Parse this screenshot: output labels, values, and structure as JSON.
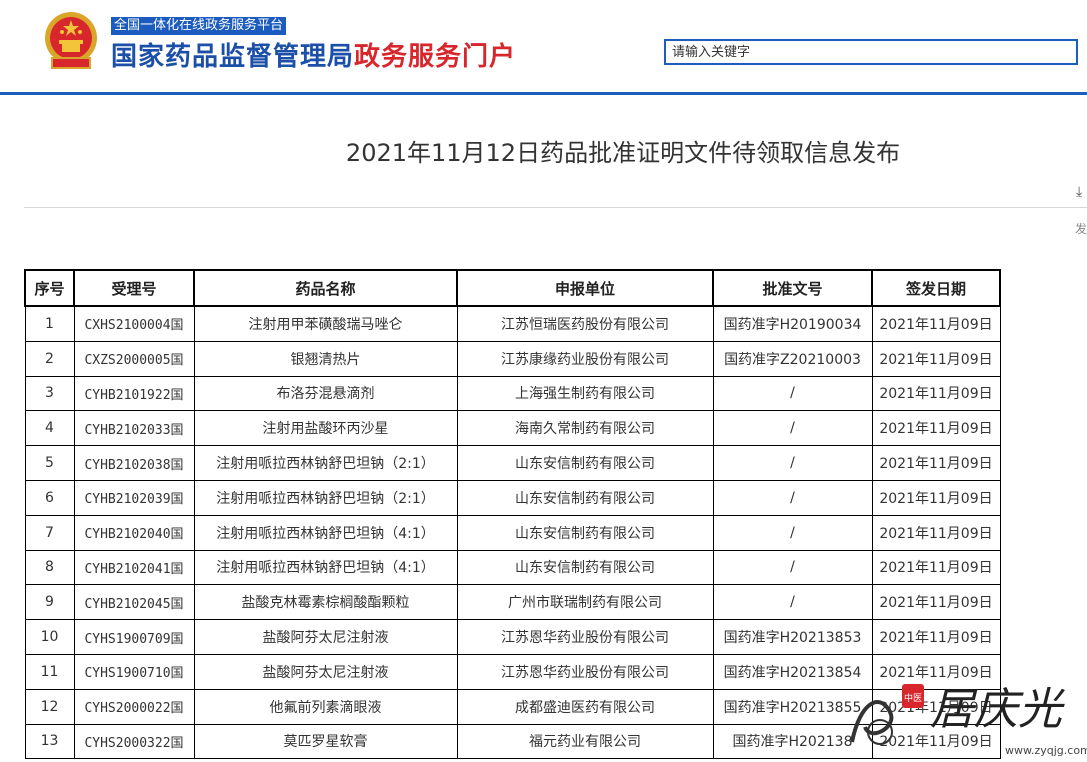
{
  "header": {
    "tagline": "全国一体化在线政务服务平台",
    "site_name_main": "国家药品监督管理局",
    "site_name_accent": "政务服务门户",
    "search_placeholder": "请输入关键字"
  },
  "page": {
    "title": "2021年11月12日药品批准证明文件待领取信息发布",
    "side_text": "发"
  },
  "table": {
    "headers": [
      "序号",
      "受理号",
      "药品名称",
      "申报单位",
      "批准文号",
      "签发日期"
    ],
    "rows": [
      {
        "no": "1",
        "code": "CXHS2100004",
        "suffix": "国",
        "name": "注射用甲苯磺酸瑞马唑仑",
        "company": "江苏恒瑞医药股份有限公司",
        "approval": "国药准字H20190034",
        "date": "2021年11月09日"
      },
      {
        "no": "2",
        "code": "CXZS2000005",
        "suffix": "国",
        "name": "银翘清热片",
        "company": "江苏康缘药业股份有限公司",
        "approval": "国药准字Z20210003",
        "date": "2021年11月09日"
      },
      {
        "no": "3",
        "code": "CYHB2101922",
        "suffix": "国",
        "name": "布洛芬混悬滴剂",
        "company": "上海强生制药有限公司",
        "approval": "/",
        "date": "2021年11月09日"
      },
      {
        "no": "4",
        "code": "CYHB2102033",
        "suffix": "国",
        "name": "注射用盐酸环丙沙星",
        "company": "海南久常制药有限公司",
        "approval": "/",
        "date": "2021年11月09日"
      },
      {
        "no": "5",
        "code": "CYHB2102038",
        "suffix": "国",
        "name": "注射用哌拉西林钠舒巴坦钠（2:1）",
        "company": "山东安信制药有限公司",
        "approval": "/",
        "date": "2021年11月09日"
      },
      {
        "no": "6",
        "code": "CYHB2102039",
        "suffix": "国",
        "name": "注射用哌拉西林钠舒巴坦钠（2:1）",
        "company": "山东安信制药有限公司",
        "approval": "/",
        "date": "2021年11月09日"
      },
      {
        "no": "7",
        "code": "CYHB2102040",
        "suffix": "国",
        "name": "注射用哌拉西林钠舒巴坦钠（4:1）",
        "company": "山东安信制药有限公司",
        "approval": "/",
        "date": "2021年11月09日"
      },
      {
        "no": "8",
        "code": "CYHB2102041",
        "suffix": "国",
        "name": "注射用哌拉西林钠舒巴坦钠（4:1）",
        "company": "山东安信制药有限公司",
        "approval": "/",
        "date": "2021年11月09日"
      },
      {
        "no": "9",
        "code": "CYHB2102045",
        "suffix": "国",
        "name": "盐酸克林霉素棕榈酸酯颗粒",
        "company": "广州市联瑞制药有限公司",
        "approval": "/",
        "date": "2021年11月09日"
      },
      {
        "no": "10",
        "code": "CYHS1900709",
        "suffix": "国",
        "name": "盐酸阿芬太尼注射液",
        "company": "江苏恩华药业股份有限公司",
        "approval": "国药准字H20213853",
        "date": "2021年11月09日"
      },
      {
        "no": "11",
        "code": "CYHS1900710",
        "suffix": "国",
        "name": "盐酸阿芬太尼注射液",
        "company": "江苏恩华药业股份有限公司",
        "approval": "国药准字H20213854",
        "date": "2021年11月09日"
      },
      {
        "no": "12",
        "code": "CYHS2000022",
        "suffix": "国",
        "name": "他氟前列素滴眼液",
        "company": "成都盛迪医药有限公司",
        "approval": "国药准字H20213855",
        "date": "2021年11月09日"
      },
      {
        "no": "13",
        "code": "CYHS2000322",
        "suffix": "国",
        "name": "莫匹罗星软膏",
        "company": "福元药业有限公司",
        "approval": "国药准字H202138",
        "date": "2021年11月09日"
      }
    ]
  },
  "watermark": {
    "text": "居庆光",
    "url": "www.zyqjg.com"
  },
  "colors": {
    "brand_blue": "#1b5fbe",
    "accent_red": "#d7262c"
  }
}
